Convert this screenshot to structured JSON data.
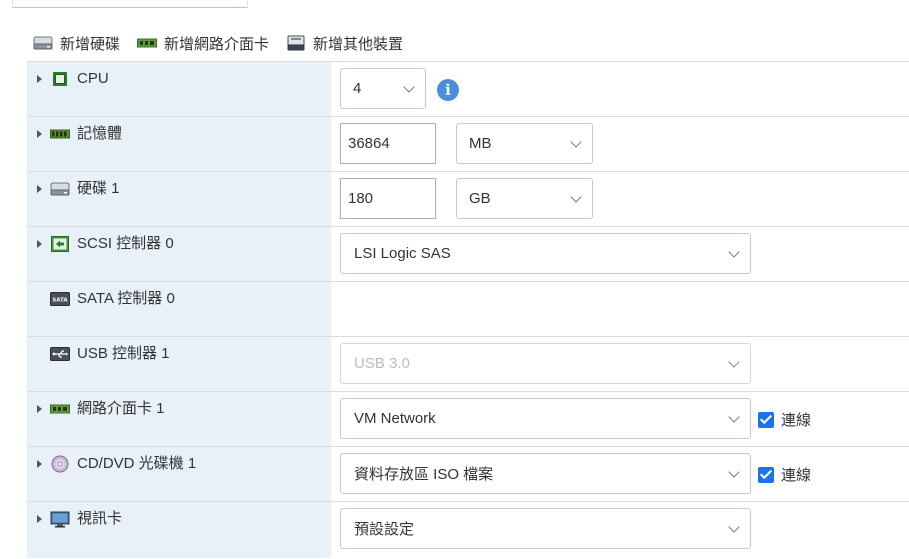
{
  "toolbar": {
    "add_disk": "新增硬碟",
    "add_nic": "新增網路介面卡",
    "add_other": "新增其他裝置"
  },
  "rows": {
    "cpu": {
      "label": "CPU",
      "value": "4"
    },
    "memory": {
      "label": "記憶體",
      "value": "36864",
      "unit": "MB"
    },
    "disk": {
      "label": "硬碟 1",
      "value": "180",
      "unit": "GB"
    },
    "scsi": {
      "label": "SCSI 控制器 0",
      "value": "LSI Logic SAS"
    },
    "sata": {
      "label": "SATA 控制器 0"
    },
    "usb": {
      "label": "USB 控制器 1",
      "value": "USB 3.0"
    },
    "nic": {
      "label": "網路介面卡 1",
      "value": "VM Network",
      "connect_label": "連線"
    },
    "cddvd": {
      "label": "CD/DVD 光碟機 1",
      "value": "資料存放區 ISO 檔案",
      "connect_label": "連線"
    },
    "video": {
      "label": "視訊卡",
      "value": "預設設定"
    }
  },
  "colors": {
    "label_bg": "#e8f1f8",
    "accent": "#1a73e8",
    "info": "#4a8fd8"
  }
}
